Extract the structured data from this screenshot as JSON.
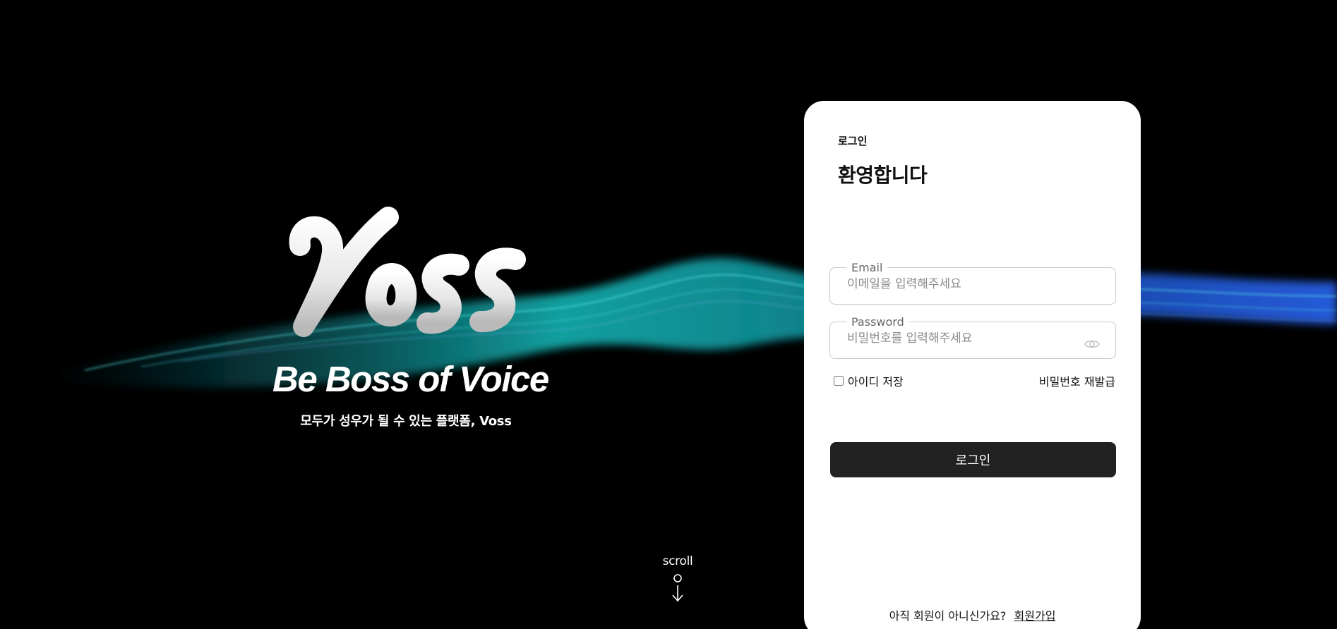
{
  "hero": {
    "logo_text": "Voss",
    "tagline": "Be Boss of Voice",
    "subtitle": "모두가 성우가 될 수 있는 플랫폼, Voss",
    "scroll_label": "scroll",
    "scroll_icon": "arrow-down-icon"
  },
  "login": {
    "eyebrow": "로그인",
    "title": "환영합니다",
    "email": {
      "label": "Email",
      "placeholder": "이메일을 입력해주세요",
      "value": ""
    },
    "password": {
      "label": "Password",
      "placeholder": "비밀번호를 입력해주세요",
      "value": "",
      "toggle_icon": "eye-icon"
    },
    "remember_label": "아이디 저장",
    "remember_checked": false,
    "reset_label": "비밀번호 재발급",
    "submit_label": "로그인",
    "signup_prompt": "아직 회원이 아니신가요?",
    "signup_link": "회원가입"
  },
  "colors": {
    "background": "#000000",
    "card": "#ffffff",
    "button": "#222222",
    "wave_teal": "#14c8c8",
    "wave_blue": "#2a6cff"
  }
}
